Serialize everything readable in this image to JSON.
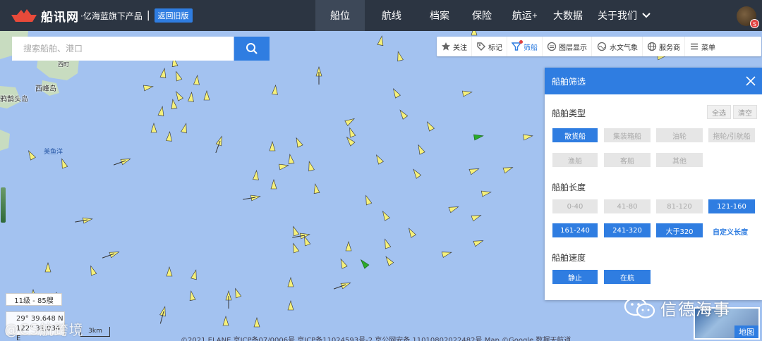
{
  "app": {
    "name": "船讯网",
    "subtitle": "·亿海蓝旗下产品",
    "separator": "|",
    "old_version_button": "返回旧版"
  },
  "nav": {
    "items": [
      {
        "label": "船位",
        "active": true
      },
      {
        "label": "航线"
      },
      {
        "label": "档案"
      },
      {
        "label": "保险"
      },
      {
        "label": "航运",
        "sup": "+"
      },
      {
        "label": "大数据"
      },
      {
        "label": "关于我们"
      }
    ],
    "avatar_badge": "S"
  },
  "search": {
    "placeholder": "搜索船舶、港口"
  },
  "toolbar": {
    "items": [
      {
        "label": "关注",
        "icon": "star-icon"
      },
      {
        "label": "标记",
        "icon": "tag-icon"
      },
      {
        "label": "筛船",
        "icon": "filter-icon",
        "active": true
      },
      {
        "label": "图层显示",
        "icon": "layers-icon"
      },
      {
        "label": "水文气象",
        "icon": "weather-icon"
      },
      {
        "label": "服务商",
        "icon": "globe-icon"
      },
      {
        "label": "菜单",
        "icon": "menu-icon"
      }
    ]
  },
  "filter_panel": {
    "title": "船舶筛选",
    "type_section": {
      "title": "船舶类型",
      "select_all": "全选",
      "clear": "清空",
      "options": [
        {
          "label": "散货船",
          "selected": true
        },
        {
          "label": "集装箱船",
          "selected": false
        },
        {
          "label": "油轮",
          "selected": false
        },
        {
          "label": "拖轮/引航船",
          "selected": false
        },
        {
          "label": "渔船",
          "selected": false
        },
        {
          "label": "客船",
          "selected": false
        },
        {
          "label": "其他",
          "selected": false
        }
      ]
    },
    "length_section": {
      "title": "船舶长度",
      "options": [
        {
          "label": "0-40",
          "selected": false
        },
        {
          "label": "41-80",
          "selected": false
        },
        {
          "label": "81-120",
          "selected": false
        },
        {
          "label": "121-160",
          "selected": true
        },
        {
          "label": "161-240",
          "selected": true
        },
        {
          "label": "241-320",
          "selected": true
        },
        {
          "label": "大于320",
          "selected": true
        }
      ],
      "custom_link": "自定义长度"
    },
    "speed_section": {
      "title": "船舶速度",
      "options": [
        {
          "label": "静止",
          "selected": true
        },
        {
          "label": "在航",
          "selected": true
        }
      ]
    }
  },
  "map": {
    "places": [
      {
        "name": "西峰岛",
        "kind": "island"
      },
      {
        "name": "鸦鹊头岛",
        "kind": "island"
      },
      {
        "name": "美鱼洋",
        "kind": "water"
      },
      {
        "name": "西町",
        "kind": "island"
      }
    ],
    "level_label": "11级 - 85艘",
    "coord_lat": "29° 39.648 N",
    "coord_lon": "122° 31.034 E",
    "scale_label": "3km",
    "copyright": "©2021 ELANE 京ICP备07/0006号 京ICP备11024593号-2 京公网安备 11010802022482号 Map ©Google 数据天航道",
    "map_toggle": "地图",
    "colors": {
      "sea": "#a3c2f0",
      "land": "#c8dcc0",
      "ship_bulk": "#f5f07a",
      "ship_green": "#2aaa2a",
      "accent": "#2f7de1"
    }
  },
  "watermarks": {
    "left": "@CS航跨境",
    "right": "信德海事"
  }
}
